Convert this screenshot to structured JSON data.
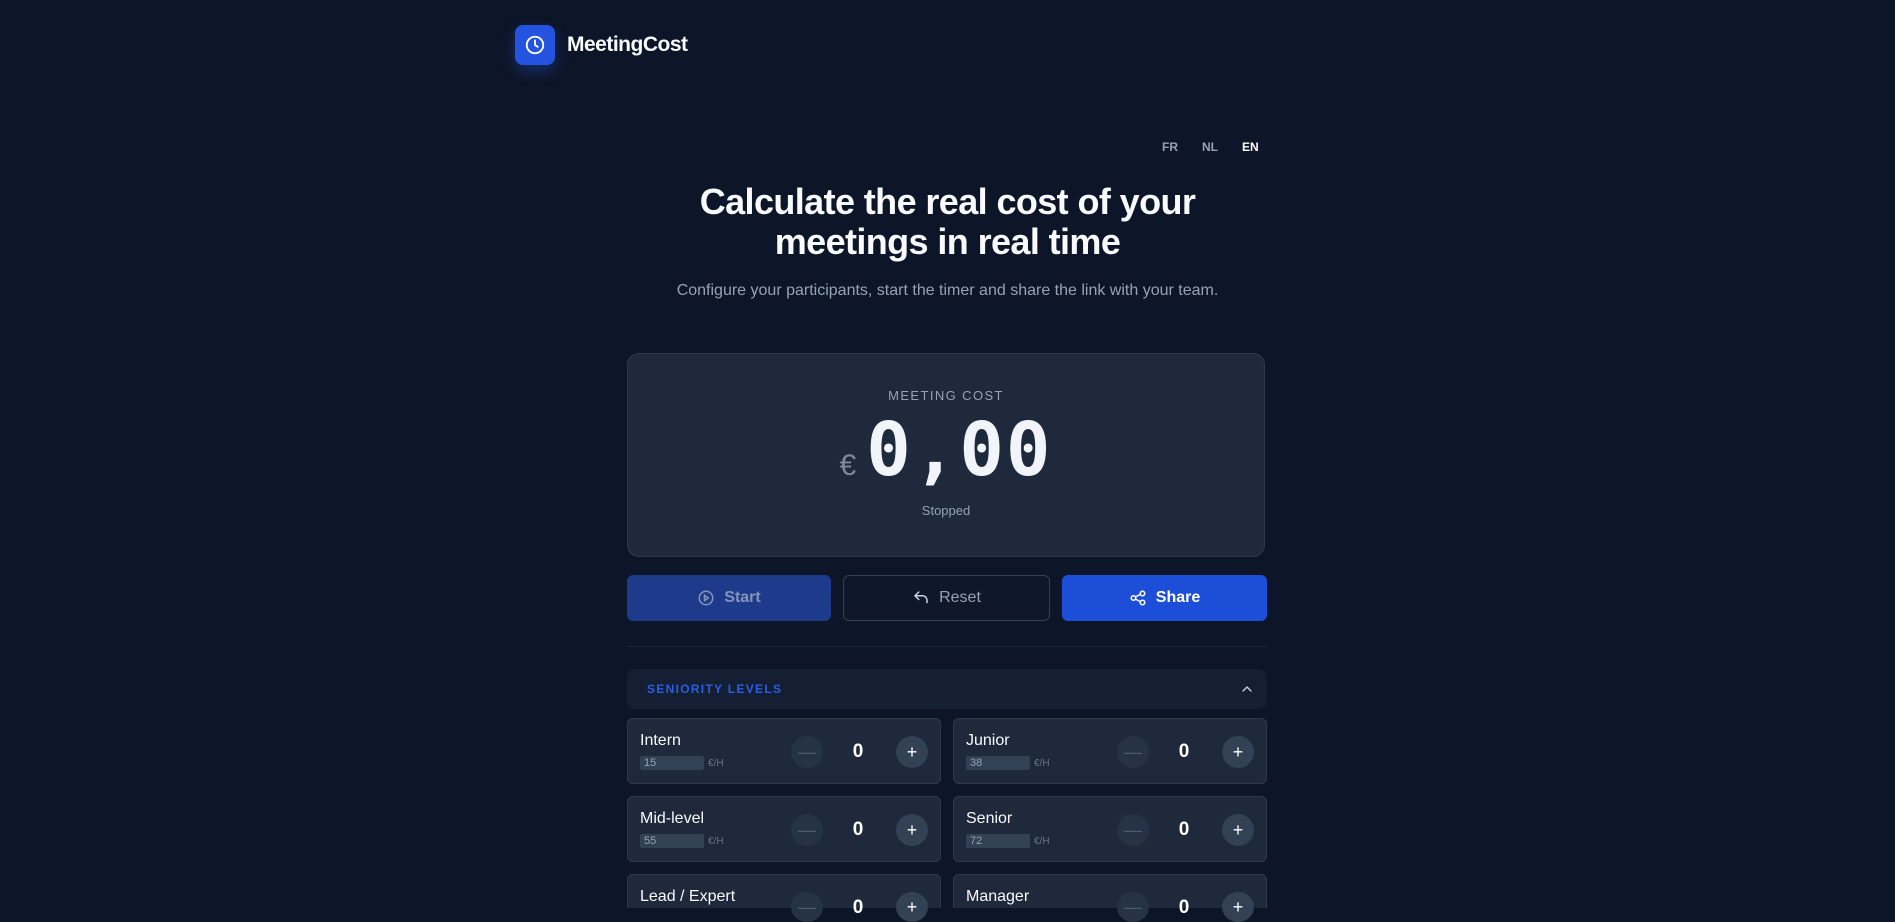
{
  "header": {
    "brand": "MeetingCost",
    "logo_icon": "clock-icon"
  },
  "languages": [
    {
      "code": "FR",
      "active": false
    },
    {
      "code": "NL",
      "active": false
    },
    {
      "code": "EN",
      "active": true
    }
  ],
  "hero": {
    "title_line1": "Calculate the real cost of your",
    "title_line2": "meetings in real time",
    "subtitle": "Configure your participants, start the timer and share the link with your team."
  },
  "cost": {
    "label": "MEETING COST",
    "currency": "€",
    "amount": "0,00",
    "status": "Stopped"
  },
  "actions": {
    "start": "Start",
    "reset": "Reset",
    "share": "Share"
  },
  "seniority": {
    "title": "SENIORITY LEVELS",
    "unit": "€/H",
    "levels": [
      {
        "name": "Intern",
        "rate": "15",
        "count": "0"
      },
      {
        "name": "Junior",
        "rate": "38",
        "count": "0"
      },
      {
        "name": "Mid-level",
        "rate": "55",
        "count": "0"
      },
      {
        "name": "Senior",
        "rate": "72",
        "count": "0"
      },
      {
        "name": "Lead / Expert",
        "rate": "",
        "count": "0"
      },
      {
        "name": "Manager",
        "rate": "",
        "count": "0"
      }
    ]
  },
  "colors": {
    "background": "#0d1628",
    "accent": "#1d4ed8",
    "card": "#1e293b"
  }
}
